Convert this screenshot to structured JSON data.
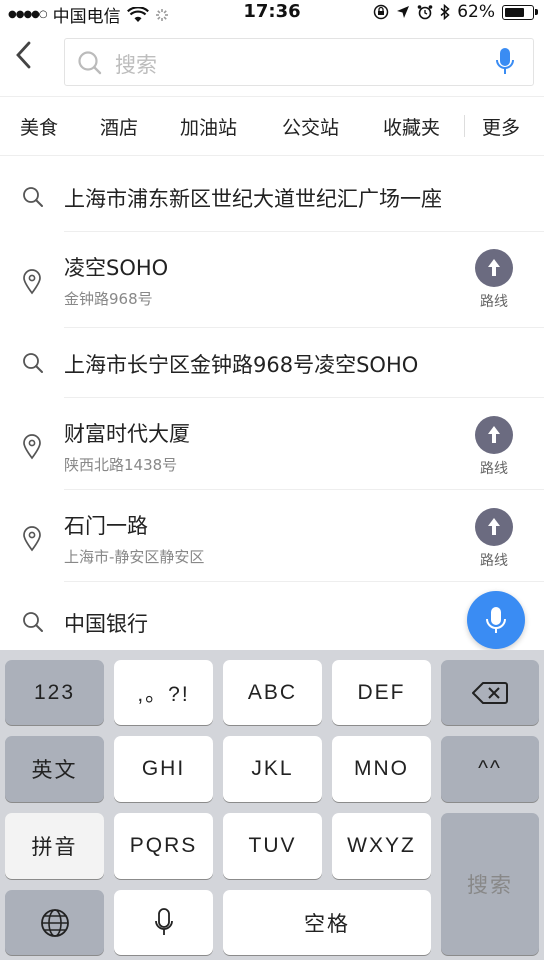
{
  "status_bar": {
    "carrier": "中国电信",
    "time": "17:36",
    "battery": "62%",
    "battery_level": 0.62
  },
  "search": {
    "placeholder": "搜索"
  },
  "categories": [
    "美食",
    "酒店",
    "加油站",
    "公交站",
    "收藏夹",
    "更多"
  ],
  "results": [
    {
      "type": "search",
      "title": "上海市浦东新区世纪大道世纪汇广场一座"
    },
    {
      "type": "place",
      "title": "凌空SOHO",
      "sub": "金钟路968号",
      "route": "路线"
    },
    {
      "type": "search",
      "title": "上海市长宁区金钟路968号凌空SOHO"
    },
    {
      "type": "place",
      "title": "财富时代大厦",
      "sub": "陕西北路1438号",
      "route": "路线"
    },
    {
      "type": "place",
      "title": "石门一路",
      "sub": "上海市-静安区静安区",
      "route": "路线"
    },
    {
      "type": "search",
      "title": "中国银行"
    }
  ],
  "keyboard": {
    "k123": "123",
    "punct": ",。?!",
    "abc": "ABC",
    "def": "DEF",
    "english": "英文",
    "ghi": "GHI",
    "jkl": "JKL",
    "mno": "MNO",
    "emoji": "^^",
    "pinyin": "拼音",
    "pqrs": "PQRS",
    "tuv": "TUV",
    "wxyz": "WXYZ",
    "space": "空格",
    "search": "搜索"
  }
}
